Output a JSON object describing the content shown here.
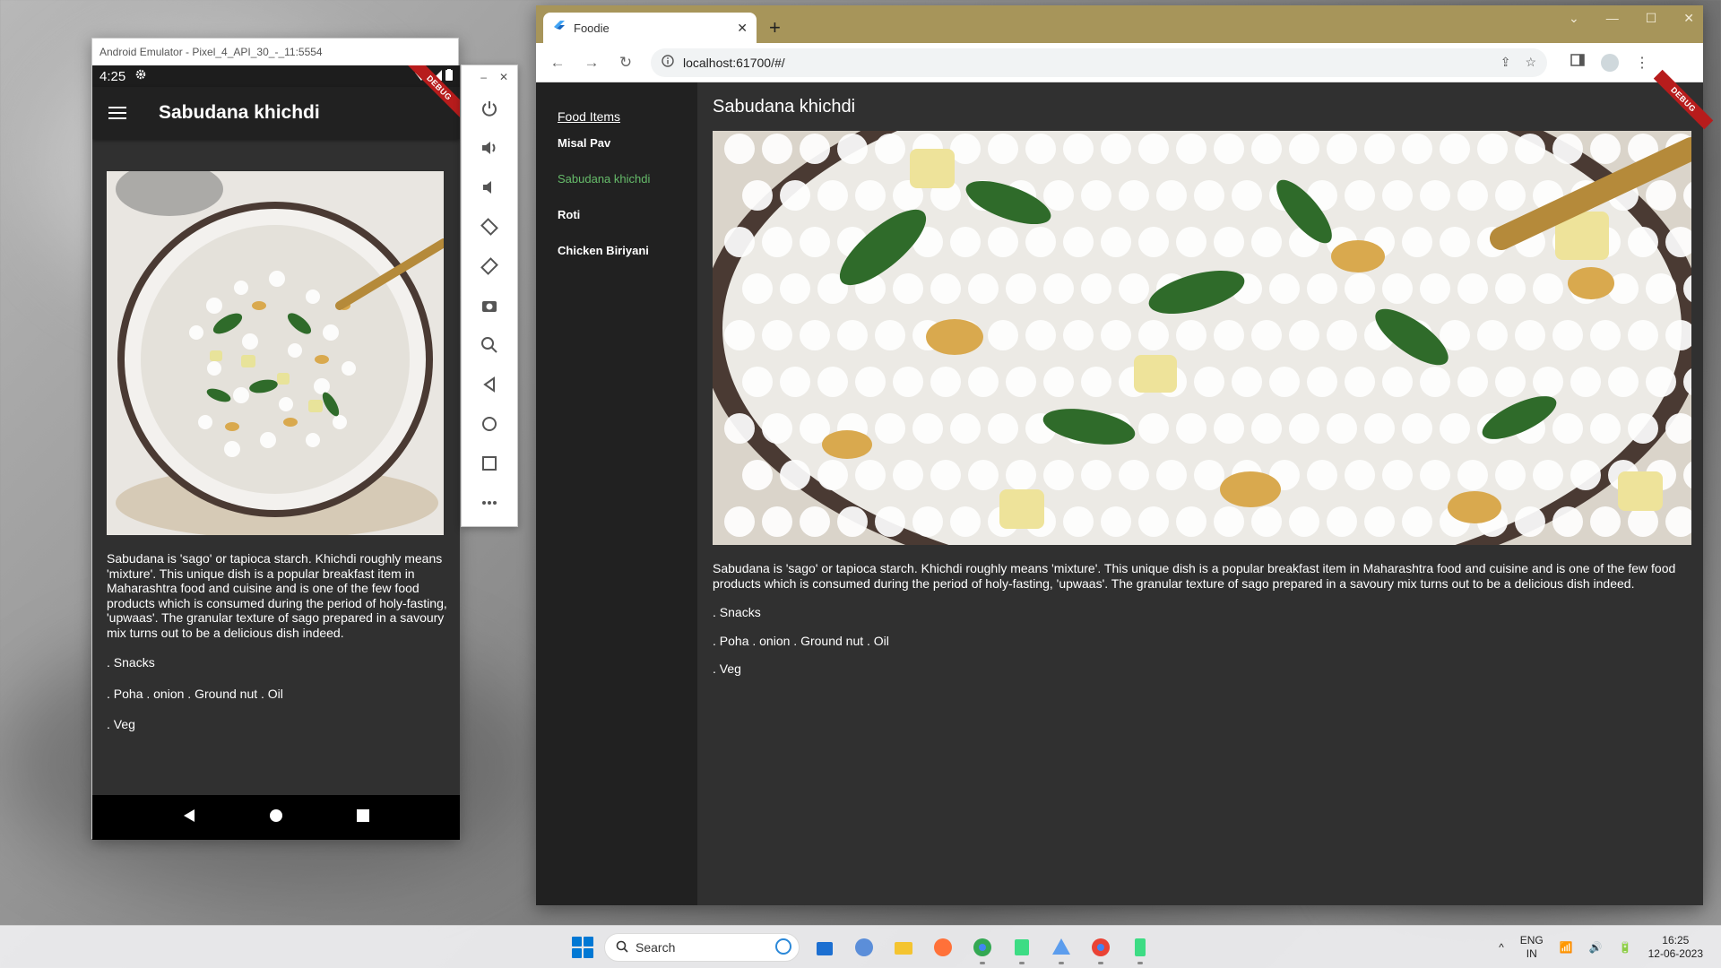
{
  "emulator": {
    "window_title": "Android Emulator - Pixel_4_API_30_-_11:5554",
    "status_time": "4:25",
    "debug_label": "DEBUG",
    "app_title": "Sabudana khichdi",
    "description": "Sabudana is 'sago' or tapioca starch. Khichdi roughly means 'mixture'. This unique dish is a popular breakfast item in Maharashtra food and cuisine and is one of the few food products which is consumed during the period of holy-fasting, 'upwaas'. The granular texture of sago prepared in a savoury mix turns out to be a delicious dish indeed.",
    "category": ". Snacks",
    "ingredients": ". Poha . onion . Ground nut . Oil",
    "diet": ". Veg",
    "toolbar_icons": [
      "power-icon",
      "volume-up-icon",
      "volume-down-icon",
      "rotate-left-icon",
      "rotate-right-icon",
      "camera-icon",
      "zoom-icon",
      "back-icon",
      "home-icon",
      "overview-icon",
      "more-icon"
    ]
  },
  "browser": {
    "tab_title": "Foodie",
    "url": "localhost:61700/#/",
    "debug_label": "DEBUG",
    "drawer": {
      "header": "Food Items",
      "items": [
        "Misal Pav",
        "Sabudana khichdi",
        "Roti",
        "Chicken Biriyani"
      ],
      "active_index": 1
    },
    "page_title": "Sabudana khichdi",
    "description": "Sabudana is 'sago' or tapioca starch. Khichdi roughly means 'mixture'. This unique dish is a popular breakfast item in Maharashtra food and cuisine and is one of the few food products which is consumed during the period of holy-fasting, 'upwaas'. The granular texture of sago prepared in a savoury mix turns out to be a delicious dish indeed.",
    "category": ". Snacks",
    "ingredients": ". Poha . onion . Ground nut . Oil",
    "diet": ". Veg"
  },
  "taskbar": {
    "search_placeholder": "Search",
    "language": "ENG",
    "region": "IN",
    "time": "16:25",
    "date": "12-06-2023"
  },
  "colors": {
    "active_drawer_item": "#66bb6a",
    "chrome_frame": "#a7955a",
    "app_bg": "#303030",
    "drawer_bg": "#212121",
    "debug_ribbon": "#b71c1c"
  }
}
